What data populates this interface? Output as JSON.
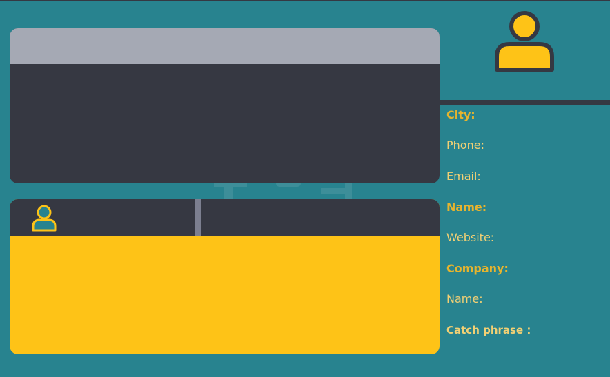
{
  "colors": {
    "background": "#28838f",
    "card_dark": "#363842",
    "card_header_gray": "#a5a9b4",
    "accent_yellow": "#fec317",
    "divider_gray": "#7c7f90",
    "label_gold": "#e6b42e",
    "label_light": "#f2d074"
  },
  "icons": {
    "avatar": "user-icon",
    "small_avatar": "user-outline-icon"
  },
  "address": {
    "heading": "City:",
    "phone_label": "Phone:",
    "email_label": "Email:",
    "name_label": "Name:",
    "website_label": "Website:"
  },
  "company": {
    "heading": "Company:",
    "name_label": "Name:",
    "catch_phrase_label": "Catch phrase :"
  }
}
